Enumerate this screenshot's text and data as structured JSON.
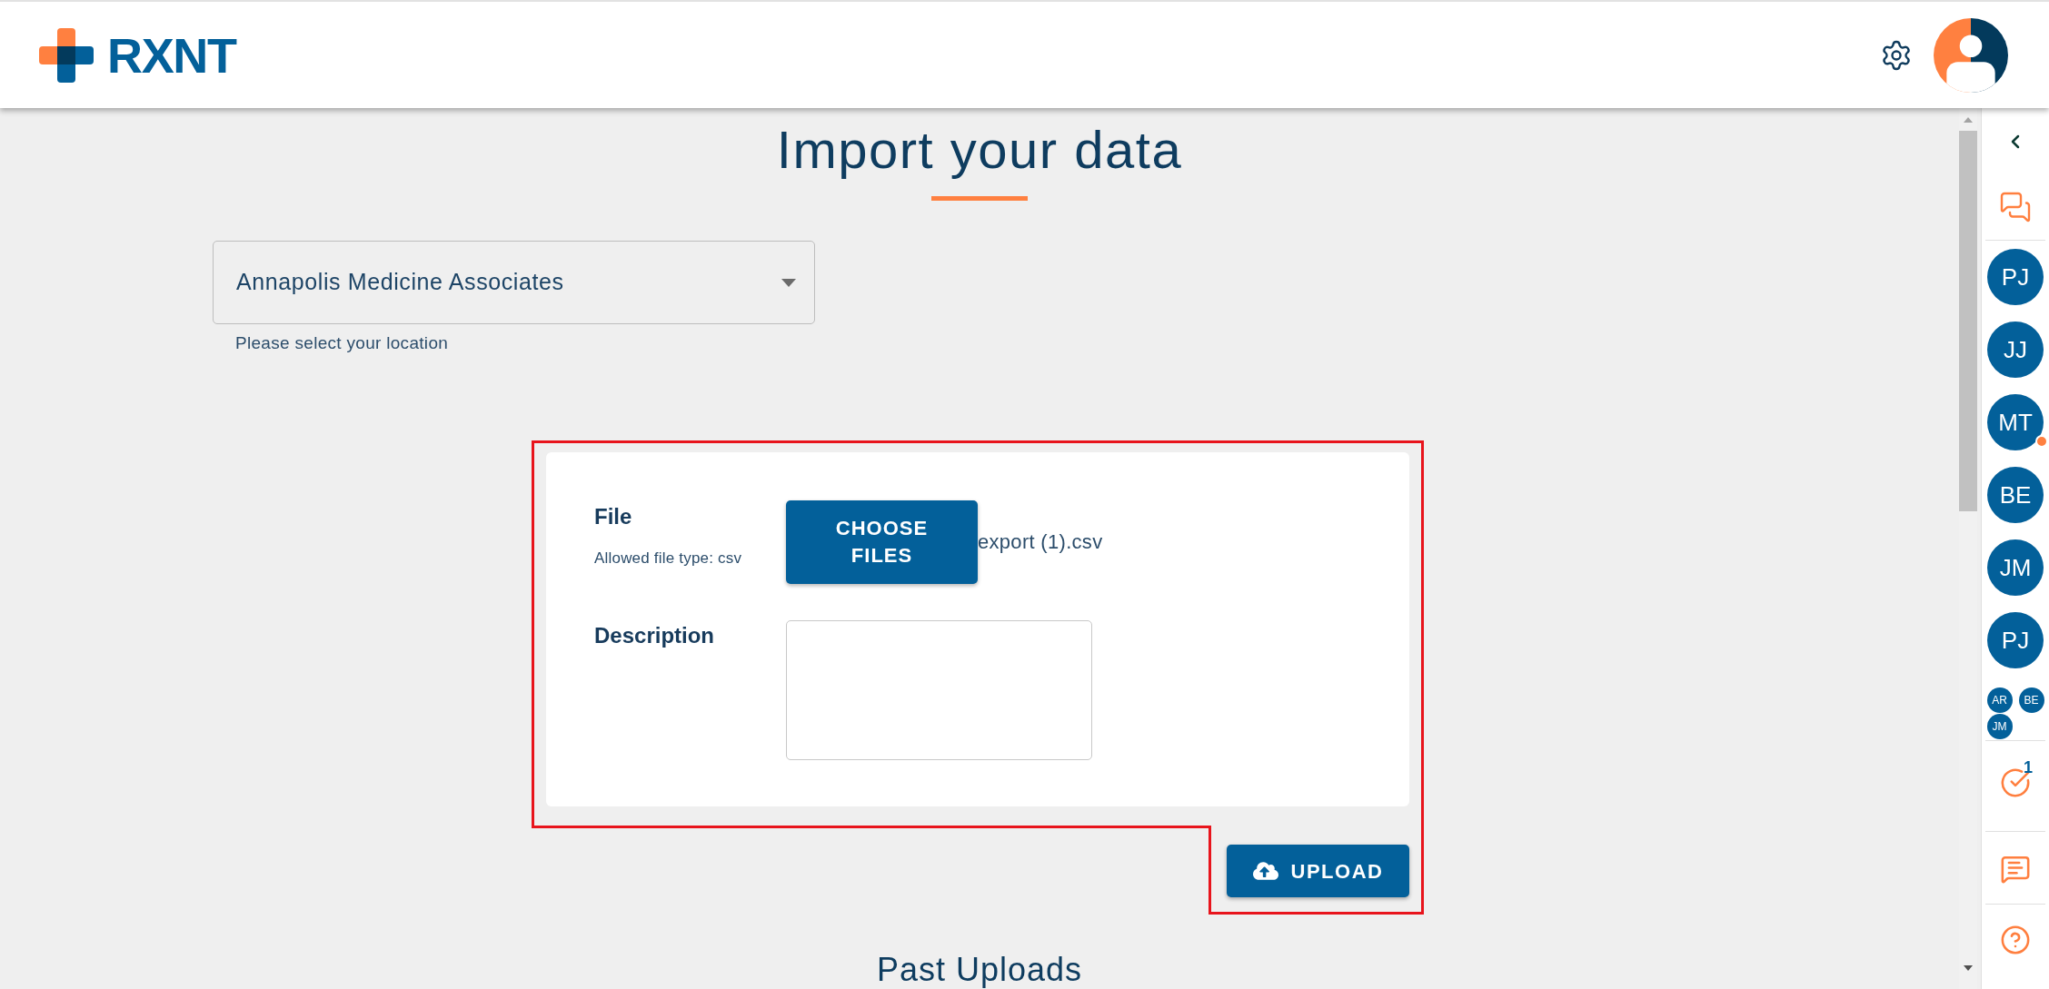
{
  "header": {
    "logo_text": "RXNT"
  },
  "page": {
    "title": "Import your data",
    "location_select": {
      "value": "Annapolis Medicine Associates",
      "helper": "Please select your location"
    },
    "upload_form": {
      "highlighted": true,
      "file_label": "File",
      "file_hint": "Allowed file type: csv",
      "choose_button": "CHOOSE FILES",
      "file_name": "export (1).csv",
      "description_label": "Description",
      "upload_button": "UPLOAD"
    },
    "past_uploads_title": "Past Uploads"
  },
  "sidebar": {
    "contacts": [
      {
        "initials": "PJ",
        "badge": false
      },
      {
        "initials": "JJ",
        "badge": false
      },
      {
        "initials": "MT",
        "badge": true
      },
      {
        "initials": "BE",
        "badge": false
      },
      {
        "initials": "JM",
        "badge": false
      },
      {
        "initials": "PJ",
        "badge": false
      }
    ],
    "group_contacts": [
      {
        "initials": "AR"
      },
      {
        "initials": "BE"
      },
      {
        "initials": "JM"
      }
    ],
    "tasks_count": "1"
  }
}
